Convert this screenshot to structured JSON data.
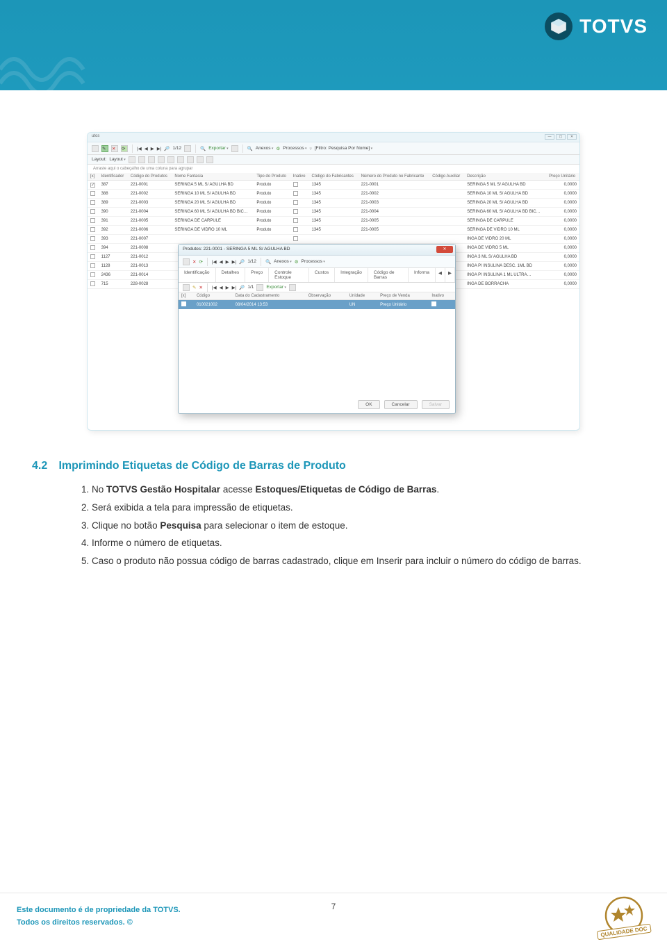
{
  "header": {
    "brand": "TOTVS"
  },
  "screenshot": {
    "titlebar_hint": "utos",
    "win_buttons": [
      "—",
      "▢",
      "✕"
    ],
    "toolbar": {
      "nav_pos": "1/12",
      "exportar": "Exportar",
      "anexos": "Anexos",
      "processos": "Processos",
      "filtro": "[Filtro: Pesquisa Por Nome]"
    },
    "subbar": {
      "layout": "Layout:",
      "layout_dd": "Layout"
    },
    "group_hint": "Arraste aqui o cabeçalho de uma coluna para agrupar",
    "columns": [
      "[x]",
      "Identificador",
      "Código do Produtos",
      "Nome Fantasia",
      "Tipo do Produto",
      "Inativo",
      "Código do Fabricantes",
      "Número do Produto no Fabricante",
      "Código Auxiliar",
      "Descrição",
      "Preço Unitário"
    ],
    "rows": [
      {
        "chk": true,
        "id": "387",
        "cod": "221-0001",
        "nome": "SERINGA 5 ML S/ AGULHA BD",
        "tipo": "Produto",
        "codfab": "1345",
        "numfab": "221-0001",
        "desc": "SERINGA 5 ML S/ AGULHA BD",
        "preco": "0,0000"
      },
      {
        "chk": false,
        "id": "388",
        "cod": "221-0002",
        "nome": "SERINGA 10 ML S/ AGULHA BD",
        "tipo": "Produto",
        "codfab": "1345",
        "numfab": "221-0002",
        "desc": "SERINGA 10 ML S/ AGULHA BD",
        "preco": "0,0000"
      },
      {
        "chk": false,
        "id": "389",
        "cod": "221-0003",
        "nome": "SERINGA 20 ML S/ AGULHA BD",
        "tipo": "Produto",
        "codfab": "1345",
        "numfab": "221-0003",
        "desc": "SERINGA 20 ML S/ AGULHA BD",
        "preco": "0,0000"
      },
      {
        "chk": false,
        "id": "390",
        "cod": "221-0004",
        "nome": "SERINGA 60 ML S/ AGULHA BD BIC…",
        "tipo": "Produto",
        "codfab": "1345",
        "numfab": "221-0004",
        "desc": "SERINGA 60 ML S/ AGULHA BD BIC…",
        "preco": "0,0000"
      },
      {
        "chk": false,
        "id": "391",
        "cod": "221-0005",
        "nome": "SERINGA DE CARPULE",
        "tipo": "Produto",
        "codfab": "1345",
        "numfab": "221-0005",
        "desc": "SERINGA DE CARPULE",
        "preco": "0,0000"
      },
      {
        "chk": false,
        "id": "392",
        "cod": "221-0006",
        "nome": "SERINGA DE VIDRO 10 ML",
        "tipo": "Produto",
        "codfab": "1345",
        "numfab": "221-0005",
        "desc": "SERINGA DE VIDRO 10 ML",
        "preco": "0,0000"
      },
      {
        "chk": false,
        "id": "393",
        "cod": "221-0007",
        "nome": "",
        "tipo": "",
        "codfab": "",
        "numfab": "",
        "desc": "INGA DE VIDRO 20 ML",
        "preco": "0,0000"
      },
      {
        "chk": false,
        "id": "394",
        "cod": "221-0008",
        "nome": "",
        "tipo": "",
        "codfab": "",
        "numfab": "",
        "desc": "INGA DE VIDRO 5 ML",
        "preco": "0,0000"
      },
      {
        "chk": false,
        "id": "1127",
        "cod": "221-0012",
        "nome": "",
        "tipo": "",
        "codfab": "",
        "numfab": "",
        "desc": "INGA 3 ML S/ AGULHA BD",
        "preco": "0,0000"
      },
      {
        "chk": false,
        "id": "1128",
        "cod": "221-0013",
        "nome": "",
        "tipo": "",
        "codfab": "",
        "numfab": "",
        "desc": "INGA P/ INSULINA DESC. 1ML BD",
        "preco": "0,0000"
      },
      {
        "chk": false,
        "id": "2436",
        "cod": "221-0014",
        "nome": "",
        "tipo": "",
        "codfab": "",
        "numfab": "",
        "desc": "INGA P/ INSULINA 1 ML ULTRA…",
        "preco": "0,0000"
      },
      {
        "chk": false,
        "id": "715",
        "cod": "228-0028",
        "nome": "",
        "tipo": "",
        "codfab": "",
        "numfab": "",
        "desc": "INGA DE BORRACHA",
        "preco": "0,0000"
      }
    ],
    "modal": {
      "title": "Produtos: 221-0001 - SERINGA 5 ML S/ AGULHA BD",
      "nav_pos": "1/12",
      "anexos": "Anexos",
      "processos": "Processos",
      "tabs": [
        "Identificação",
        "Detalhes",
        "Preço",
        "Controle Estoque",
        "Custos",
        "Integração",
        "Código de Barras",
        "Informa"
      ],
      "sub_nav": "1/1",
      "exportar": "Exportar",
      "grid_cols": [
        "[x]",
        "Código",
        "Data do Cadastramento",
        "Observação",
        "Unidade",
        "Preço de Venda",
        "Inativo"
      ],
      "grid_row": {
        "codigo": "010021002",
        "data": "08/04/2014 13:53",
        "obs": "",
        "un": "UN",
        "preco": "Preço Unitário"
      },
      "buttons": {
        "ok": "OK",
        "cancelar": "Cancelar",
        "salvar": "Salvar"
      }
    }
  },
  "section": {
    "num": "4.2",
    "title": "Imprimindo Etiquetas de Código de Barras de Produto",
    "items": [
      "No TOTVS Gestão Hospitalar acesse Estoques/Etiquetas de Código de Barras.",
      "Será exibida a tela para impressão de etiquetas.",
      "Clique no botão Pesquisa para selecionar o item de estoque.",
      "Informe o número de etiquetas.",
      "Caso o produto não possua código de barras cadastrado, clique em Inserir para incluir o número do código de barras."
    ],
    "bold1a": "TOTVS Gestão Hospitalar",
    "bold1b": "Estoques/Etiquetas de Código de Barras",
    "bold3": "Pesquisa"
  },
  "footer": {
    "line1": "Este documento é de propriedade da TOTVS.",
    "line2": "Todos os direitos reservados. ©",
    "page": "7",
    "badge": "QUALIDADE DOC"
  }
}
